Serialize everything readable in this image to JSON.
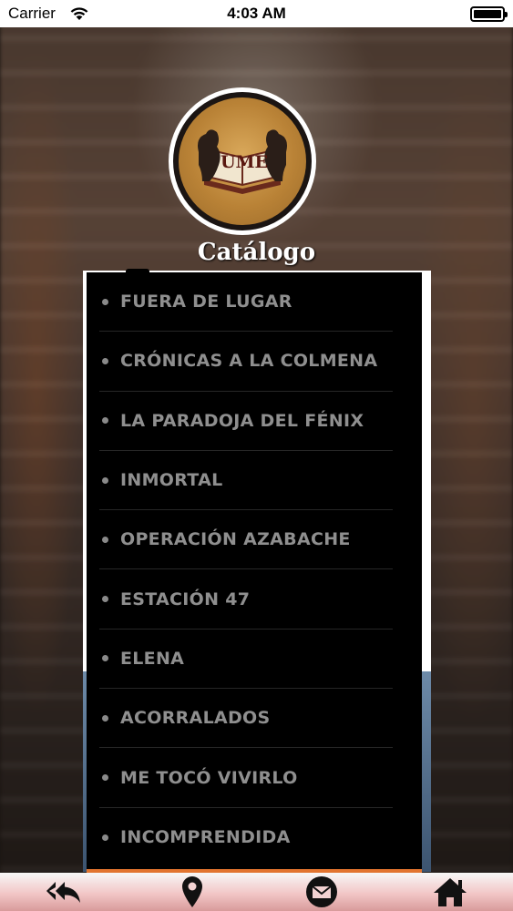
{
  "status_bar": {
    "carrier": "Carrier",
    "time": "4:03 AM"
  },
  "logo": {
    "text": "UME"
  },
  "header": {
    "title": "Catálogo"
  },
  "catalog": {
    "items": [
      {
        "label": "FUERA DE LUGAR"
      },
      {
        "label": "CRÓNICAS A LA COLMENA"
      },
      {
        "label": "LA PARADOJA DEL FÉNIX"
      },
      {
        "label": "INMORTAL"
      },
      {
        "label": "OPERACIÓN AZABACHE"
      },
      {
        "label": "ESTACIÓN 47"
      },
      {
        "label": "ELENA"
      },
      {
        "label": "ACORRALADOS"
      },
      {
        "label": "ME TOCÓ VIVIRLO"
      },
      {
        "label": "INCOMPRENDIDA"
      }
    ]
  },
  "tab_bar": {
    "icons": [
      "reply-all-icon",
      "map-pin-icon",
      "mail-icon",
      "home-icon"
    ]
  },
  "colors": {
    "accent": "#e2742f",
    "list_text": "#8f8f8f",
    "panel_bg": "#000000"
  }
}
